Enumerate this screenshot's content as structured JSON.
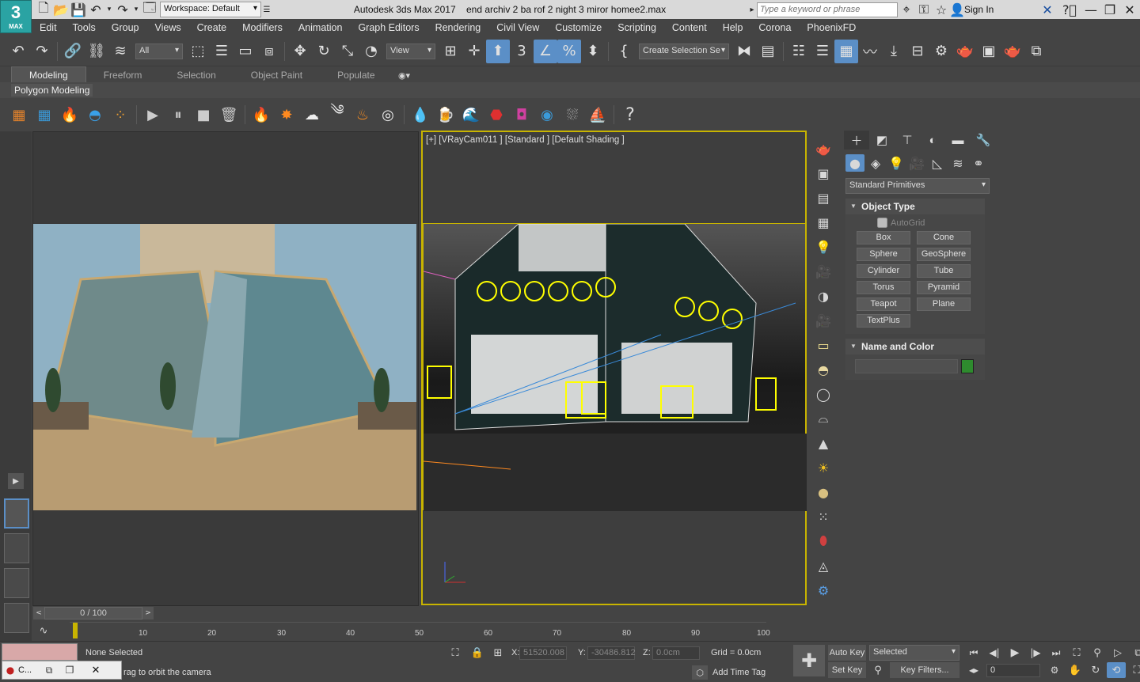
{
  "title_bar": {
    "logo_text": "3",
    "logo_sub": "MAX",
    "workspace": "Workspace: Default",
    "app_title": "Autodesk 3ds Max 2017",
    "file_title": "end archiv 2 ba rof 2 night 3 miror homee2.max",
    "search_placeholder": "Type a keyword or phrase",
    "sign_in": "Sign In"
  },
  "menu": [
    "Edit",
    "Tools",
    "Group",
    "Views",
    "Create",
    "Modifiers",
    "Animation",
    "Graph Editors",
    "Rendering",
    "Civil View",
    "Customize",
    "Scripting",
    "Content",
    "Help",
    "Corona",
    "PhoenixFD"
  ],
  "toolbar": {
    "filter_select": "All",
    "ref_coord": "View",
    "selection_set": "Create Selection Se"
  },
  "ribbon": {
    "tabs": [
      "Modeling",
      "Freeform",
      "Selection",
      "Object Paint",
      "Populate"
    ],
    "active": "Modeling",
    "panel_label": "Polygon Modeling"
  },
  "viewport": {
    "label": "[+] [VRayCam011 ] [Standard ] [Default Shading ]"
  },
  "command_panel": {
    "dropdown": "Standard Primitives",
    "object_type_title": "Object Type",
    "autogrid": "AutoGrid",
    "buttons": [
      "Box",
      "Cone",
      "Sphere",
      "GeoSphere",
      "Cylinder",
      "Tube",
      "Torus",
      "Pyramid",
      "Teapot",
      "Plane",
      "TextPlus"
    ],
    "name_color_title": "Name and Color",
    "color": "#2e8b2e"
  },
  "timeline": {
    "frame_counter": "0 / 100",
    "ticks": [
      "10",
      "20",
      "30",
      "40",
      "50",
      "60",
      "70",
      "80",
      "90",
      "100"
    ]
  },
  "status": {
    "selection": "None Selected",
    "prompt": "rag to orbit the camera",
    "x_label": "X:",
    "x_value": "51520.008",
    "y_label": "Y:",
    "y_value": "-30486.812",
    "z_label": "Z:",
    "z_value": "0.0cm",
    "grid": "Grid = 0.0cm",
    "add_time_tag": "Add Time Tag",
    "auto_key": "Auto Key",
    "selected": "Selected",
    "set_key": "Set Key",
    "key_filters": "Key Filters...",
    "frame": "0",
    "taskbar_item": "C..."
  }
}
